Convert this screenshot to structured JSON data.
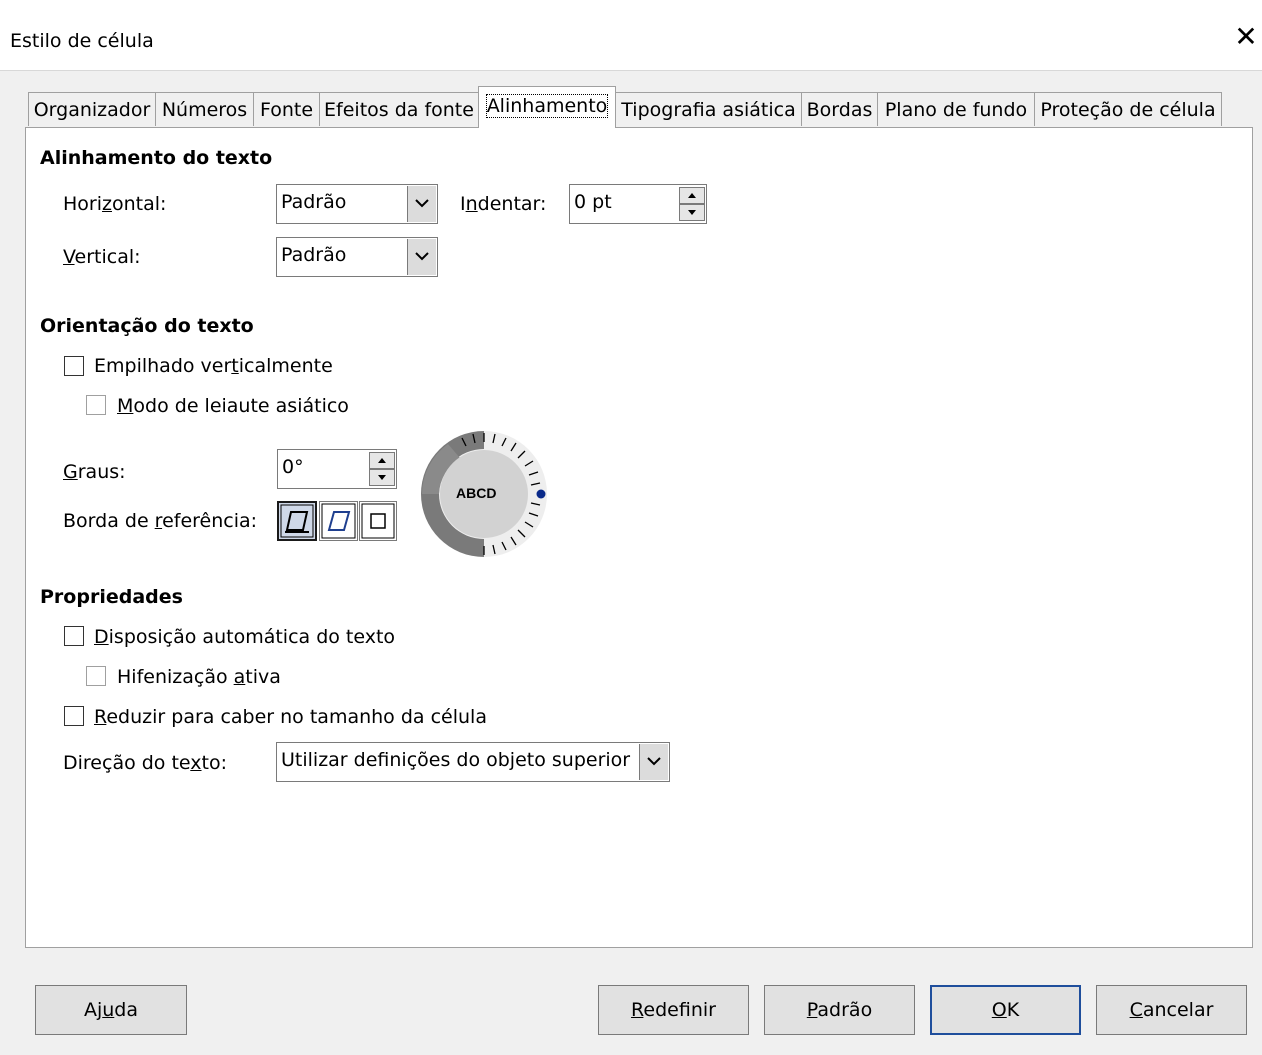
{
  "window": {
    "title": "Estilo de célula",
    "close_glyph": "✕"
  },
  "tabs": [
    {
      "label": "Organizador"
    },
    {
      "label": "Números"
    },
    {
      "label": "Fonte"
    },
    {
      "label": "Efeitos da fonte"
    },
    {
      "label": "Alinhamento",
      "active": true
    },
    {
      "label": "Tipografia asiática"
    },
    {
      "label": "Bordas"
    },
    {
      "label": "Plano de fundo"
    },
    {
      "label": "Proteção de célula"
    }
  ],
  "text_alignment": {
    "heading": "Alinhamento do texto",
    "horizontal_label_pre": "Hori",
    "horizontal_label_u": "z",
    "horizontal_label_post": "ontal:",
    "horizontal_value": "Padrão",
    "indent_label_pre": "I",
    "indent_label_u": "n",
    "indent_label_post": "dentar:",
    "indent_value": "0 pt",
    "vertical_label_u": "V",
    "vertical_label_post": "ertical:",
    "vertical_value": "Padrão"
  },
  "text_orientation": {
    "heading": "Orientação do texto",
    "stacked_pre": "Empilhado ver",
    "stacked_u": "t",
    "stacked_post": "icalmente",
    "asian_u": "M",
    "asian_post": "odo de leiaute asiático",
    "degrees_label_u": "G",
    "degrees_label_post": "raus:",
    "degrees_value": "0°",
    "ref_edge_pre": "Borda de ",
    "ref_edge_u": "r",
    "ref_edge_post": "eferência:",
    "dial_text": "ABCD",
    "dial_angle_degrees": 0
  },
  "properties": {
    "heading": "Propriedades",
    "wrap_u": "D",
    "wrap_post": "isposição automática do texto",
    "hyph_pre": "Hifenização ",
    "hyph_u": "a",
    "hyph_post": "tiva",
    "shrink_u": "R",
    "shrink_post": "eduzir para caber no tamanho da célula",
    "direction_label_pre": "Direção do te",
    "direction_label_u": "x",
    "direction_label_post": "to:",
    "direction_value": "Utilizar definições do objeto superior"
  },
  "buttons": {
    "help_pre": "Aj",
    "help_u": "u",
    "help_post": "da",
    "reset_u": "R",
    "reset_post": "edefinir",
    "default_u": "P",
    "default_post": "adrão",
    "ok_u": "O",
    "ok_post": "K",
    "cancel_u": "C",
    "cancel_post": "ancelar"
  }
}
